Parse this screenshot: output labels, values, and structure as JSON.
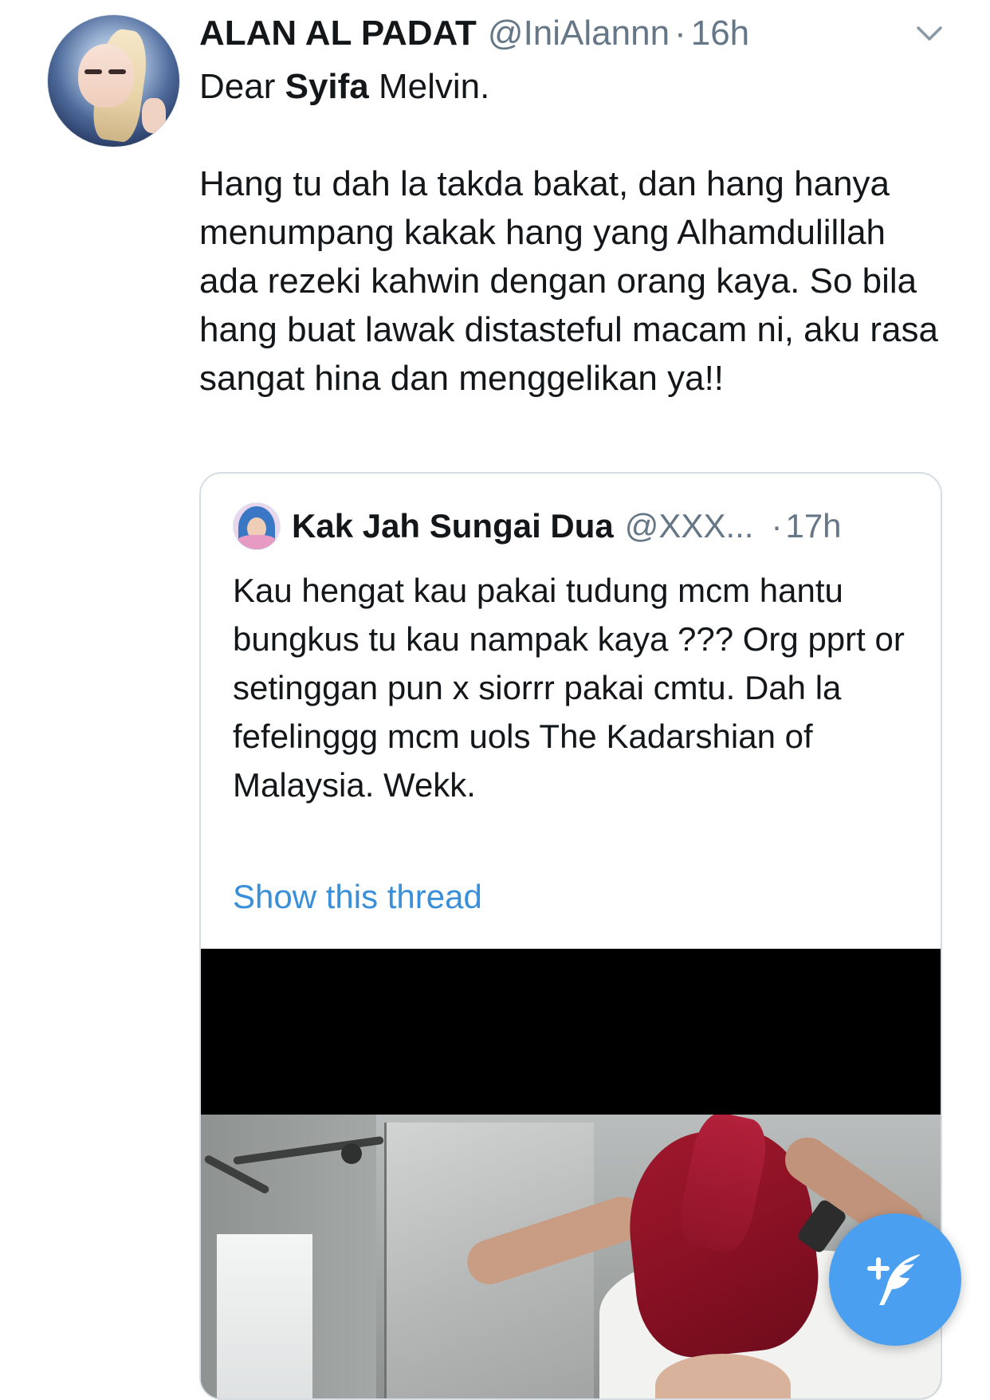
{
  "tweet": {
    "author_name": "ALAN AL PADAT",
    "author_handle": "@IniAlannn",
    "separator": "·",
    "time": "16h",
    "avatar_icon": "profile-photo",
    "menu_icon": "chevron-down-icon",
    "text_line1_prefix": "Dear ",
    "text_line1_bold": "Syifa",
    "text_line1_suffix": " Melvin.",
    "text_paragraph2": "Hang tu dah la takda bakat, dan hang hanya menumpang kakak hang yang Alhamdulillah ada rezeki kahwin dengan orang kaya. So bila hang buat lawak distasteful macam ni, aku rasa sangat hina dan menggelikan ya!!"
  },
  "quoted_tweet": {
    "author_name": "Kak Jah Sungai Dua",
    "author_handle": "@XXX...",
    "separator": "·",
    "time": "17h",
    "text": "Kau hengat kau pakai tudung mcm hantu bungkus tu kau nampak kaya ??? Org pprt or setinggan pun x siorrr pakai cmtu. Dah la fefelinggg mcm uols The Kadarshian of Malaysia. Wekk.",
    "show_thread_label": "Show this thread",
    "media_type": "video"
  },
  "compose_button": {
    "icon": "compose-tweet-icon"
  },
  "colors": {
    "link": "#3a8fd9",
    "secondary_text": "#657786",
    "primary_text": "#14171a",
    "fab": "#4a9ff0",
    "border": "#d6dde3"
  }
}
